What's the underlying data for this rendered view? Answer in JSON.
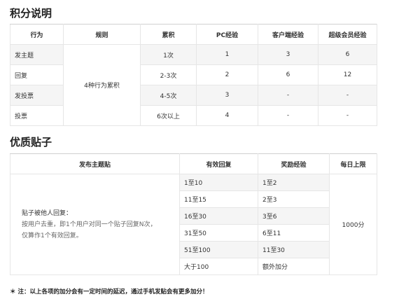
{
  "points": {
    "title": "积分说明",
    "headers": [
      "行为",
      "规则",
      "累积",
      "PC经验",
      "客户端经验",
      "超级会员经验"
    ],
    "rule": "4种行为累积",
    "rows": [
      {
        "action": "发主题",
        "count": "1次",
        "pc": "1",
        "client": "3",
        "vip": "6"
      },
      {
        "action": "回复",
        "count": "2-3次",
        "pc": "2",
        "client": "6",
        "vip": "12"
      },
      {
        "action": "发投票",
        "count": "4-5次",
        "pc": "3",
        "client": "-",
        "vip": "-"
      },
      {
        "action": "投票",
        "count": "6次以上",
        "pc": "4",
        "client": "-",
        "vip": "-"
      }
    ]
  },
  "quality": {
    "title": "优质贴子",
    "headers": [
      "发布主题贴",
      "有效回复",
      "奖励经验",
      "每日上限"
    ],
    "desc_line1": "贴子被他人回复：",
    "desc_line2": "按用户去重，即1个用户对同一个贴子回复N次，",
    "desc_line3": "仅算作1个有效回复。",
    "limit": "1000分",
    "rows": [
      {
        "reply": "1至10",
        "reward": "1至2"
      },
      {
        "reply": "11至15",
        "reward": "2至3"
      },
      {
        "reply": "16至30",
        "reward": "3至6"
      },
      {
        "reply": "31至50",
        "reward": "6至11"
      },
      {
        "reply": "51至100",
        "reward": "11至30"
      },
      {
        "reply": "大于100",
        "reward": "额外加分"
      }
    ]
  },
  "note": "＊ 注：以上各项的加分会有一定时间的延迟，通过手机发贴会有更多加分！"
}
